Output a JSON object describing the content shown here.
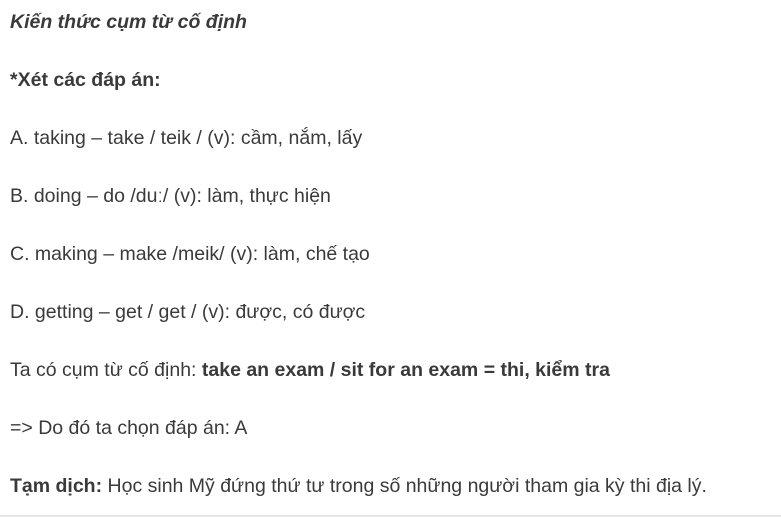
{
  "heading": "Kiến thức cụm từ cố định",
  "options_title": "*Xét các đáp án:",
  "options": [
    "A. taking – take / teik / (v): cầm, nắm, lấy",
    "B. doing – do /duː/ (v): làm, thực hiện",
    "C. making – make /meik/ (v): làm, chế tạo",
    "D. getting – get / get / (v): được, có được"
  ],
  "phrase": {
    "prefix": "Ta có cụm từ cố định: ",
    "highlight": "take an exam / sit for an exam = thi, kiểm tra"
  },
  "conclusion": "=> Do đó ta chọn đáp án: A",
  "translation": {
    "label": "Tạm dịch:",
    "text": " Học sinh Mỹ đứng thứ tư trong số những người tham gia kỳ thi địa lý."
  }
}
